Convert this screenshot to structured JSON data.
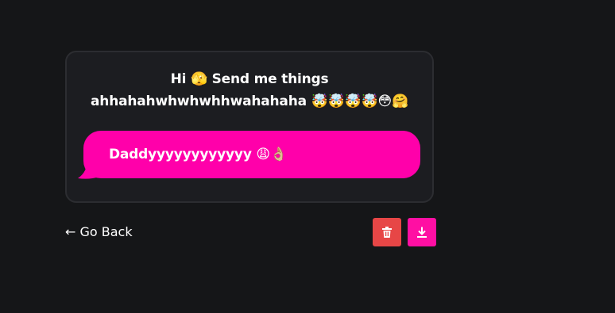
{
  "card": {
    "prompt_line1": "Hi 🫣 Send me things",
    "prompt_line2": "ahhahahwhwhwhhwahahaha 🤯🤯🤯🤯😳🤗",
    "message": "Daddyyyyyyyyyyyy 😩👌🏼"
  },
  "nav": {
    "back_label": "← Go Back"
  },
  "actions": {
    "delete_icon": "trash-icon",
    "download_icon": "download-icon"
  },
  "colors": {
    "background": "#151618",
    "card": "#1c1d21",
    "bubble": "#ff00aa",
    "delete": "#e74646",
    "download": "#ff0fa3"
  }
}
